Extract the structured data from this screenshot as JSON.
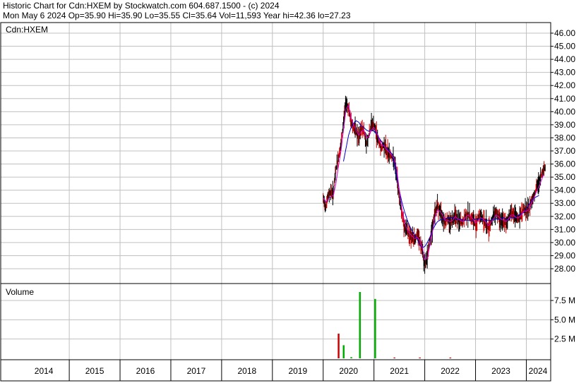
{
  "header": {
    "line1": "Historic Chart for Cdn:HXEM by Stockwatch.com 604.687.1500 - (c) 2024",
    "line2": "Mon May  6 2024  Op=35.90  Hi=35.90  Lo=35.55  Cl=35.64  Vol=11,593  Year hi=42.36  lo=27.23"
  },
  "colors": {
    "price_bar": "#000000",
    "price_bar_down": "#cc0000",
    "ma_short": "#cc00cc",
    "ma_long": "#0000cc",
    "vol_up": "#00aa00",
    "vol_down": "#cc0000",
    "grid": "#c0c0c0"
  },
  "chart_data": [
    {
      "type": "line",
      "title": "Cdn:HXEM",
      "ylim": [
        27,
        46.5
      ],
      "y_ticks": [
        "46.00",
        "45.00",
        "44.00",
        "43.00",
        "42.00",
        "41.00",
        "40.00",
        "39.00",
        "38.00",
        "37.00",
        "36.00",
        "35.00",
        "34.00",
        "33.00",
        "32.00",
        "31.00",
        "30.00",
        "29.00",
        "28.00"
      ],
      "x_labels": [
        "2014",
        "2015",
        "2016",
        "2017",
        "2018",
        "2019",
        "2020",
        "2021",
        "2022",
        "2023",
        "2024"
      ],
      "grid": true,
      "series": [
        {
          "values_key": "price",
          "x": [
            2020.0,
            2020.05,
            2020.1,
            2020.15,
            2020.2,
            2020.25,
            2020.3,
            2020.35,
            2020.4,
            2020.45,
            2020.5,
            2020.55,
            2020.6,
            2020.65,
            2020.7,
            2020.75,
            2020.8,
            2020.85,
            2020.9,
            2020.95,
            2021.0,
            2021.05,
            2021.1,
            2021.15,
            2021.2,
            2021.25,
            2021.3,
            2021.35,
            2021.4,
            2021.45,
            2021.5,
            2021.55,
            2021.6,
            2021.65,
            2021.7,
            2021.75,
            2021.8,
            2021.85,
            2021.9,
            2021.95,
            2022.0,
            2022.05,
            2022.1,
            2022.15,
            2022.2,
            2022.25,
            2022.3,
            2022.35,
            2022.4,
            2022.45,
            2022.5,
            2022.55,
            2022.6,
            2022.65,
            2022.7,
            2022.75,
            2022.8,
            2022.85,
            2022.9,
            2022.95,
            2023.0,
            2023.05,
            2023.1,
            2023.15,
            2023.2,
            2023.25,
            2023.3,
            2023.35,
            2023.4,
            2023.45,
            2023.5,
            2023.55,
            2023.6,
            2023.65,
            2023.7,
            2023.75,
            2023.8,
            2023.85,
            2023.9,
            2023.95,
            2024.0,
            2024.05,
            2024.1,
            2024.15,
            2024.2,
            2024.25,
            2024.3,
            2024.34
          ],
          "close": [
            33.3,
            32.8,
            33.6,
            33.9,
            33.7,
            35.6,
            36.5,
            37.4,
            39.2,
            40.8,
            40.2,
            39.2,
            38.8,
            38.5,
            37.9,
            38.7,
            38.6,
            37.5,
            38.2,
            39.1,
            38.9,
            38.3,
            37.6,
            37.2,
            37.5,
            37.0,
            36.8,
            36.6,
            36.2,
            35.0,
            33.4,
            32.2,
            31.2,
            30.9,
            30.6,
            30.4,
            30.2,
            30.6,
            30.1,
            29.4,
            28.2,
            28.9,
            30.2,
            31.1,
            32.3,
            32.8,
            32.4,
            32.0,
            31.6,
            31.8,
            31.5,
            31.8,
            32.2,
            31.7,
            31.6,
            31.5,
            32.0,
            32.2,
            31.9,
            31.8,
            31.3,
            31.9,
            32.1,
            31.7,
            31.5,
            31.1,
            31.5,
            32.0,
            32.4,
            32.0,
            31.7,
            31.6,
            31.4,
            31.9,
            32.4,
            32.1,
            31.9,
            31.8,
            32.2,
            32.6,
            32.4,
            32.5,
            33.2,
            33.6,
            34.2,
            34.6,
            35.2,
            35.64
          ]
        }
      ],
      "ma_short": [
        33.4,
        33.1,
        33.3,
        33.5,
        33.6,
        34.5,
        35.8,
        37.0,
        38.6,
        40.2,
        40.5,
        39.5,
        39.0,
        38.6,
        38.2,
        38.5,
        38.6,
        38.0,
        38.1,
        38.6,
        38.8,
        38.4,
        37.9,
        37.4,
        37.4,
        37.1,
        36.9,
        36.7,
        36.4,
        35.5,
        34.0,
        32.6,
        31.6,
        31.0,
        30.7,
        30.5,
        30.3,
        30.4,
        30.2,
        29.7,
        28.7,
        28.8,
        29.8,
        30.8,
        31.9,
        32.5,
        32.4,
        32.1,
        31.7,
        31.7,
        31.6,
        31.7,
        32.0,
        31.8,
        31.7,
        31.6,
        31.9,
        32.1,
        32.0,
        31.8,
        31.5,
        31.7,
        31.9,
        31.8,
        31.6,
        31.3,
        31.5,
        31.8,
        32.1,
        32.0,
        31.8,
        31.7,
        31.6,
        31.8,
        32.1,
        32.1,
        31.9,
        31.9,
        32.1,
        32.4,
        32.4,
        32.5,
        33.0,
        33.4,
        33.9,
        34.3,
        34.8,
        35.2
      ],
      "ma_long_start_index": 8,
      "ma_long": [
        36.2,
        37.2,
        38.2,
        38.8,
        39.1,
        39.3,
        39.2,
        38.9,
        38.8,
        38.6,
        38.5,
        38.6,
        38.5,
        38.3,
        38.0,
        37.7,
        37.4,
        37.2,
        37.0,
        36.8,
        36.0,
        35.0,
        34.0,
        33.1,
        32.4,
        31.8,
        31.3,
        30.9,
        30.6,
        30.3,
        29.8,
        29.6,
        29.7,
        30.0,
        30.4,
        30.9,
        31.3,
        31.6,
        31.7,
        31.8,
        31.8,
        31.9,
        31.9,
        31.9,
        31.8,
        31.8,
        31.8,
        31.7,
        31.7,
        31.7,
        31.7,
        31.7,
        31.8,
        31.8,
        31.8,
        31.7,
        31.7,
        31.7,
        31.7,
        31.8,
        31.8,
        31.8,
        31.8,
        31.9,
        31.8,
        31.8,
        31.9,
        31.9,
        32.0,
        32.1,
        32.2,
        32.3,
        32.6,
        32.9,
        33.2,
        33.4,
        33.5,
        33.6
      ]
    },
    {
      "type": "bar",
      "title": "Volume",
      "ylim": [
        0,
        9
      ],
      "y_ticks": [
        "7.5 M",
        "5.0 M",
        "2.5 M"
      ],
      "y_tick_values": [
        7.5,
        5.0,
        2.5
      ],
      "series": [
        {
          "x": [
            2020.3,
            2020.4,
            2020.55,
            2020.72,
            2021.02,
            2021.4,
            2021.9,
            2022.5
          ],
          "values": [
            3.2,
            1.7,
            0.15,
            8.6,
            7.7,
            0.1,
            0.1,
            0.1
          ],
          "direction": [
            "down",
            "up",
            "up",
            "up",
            "up",
            "down",
            "down",
            "down"
          ]
        }
      ]
    }
  ]
}
